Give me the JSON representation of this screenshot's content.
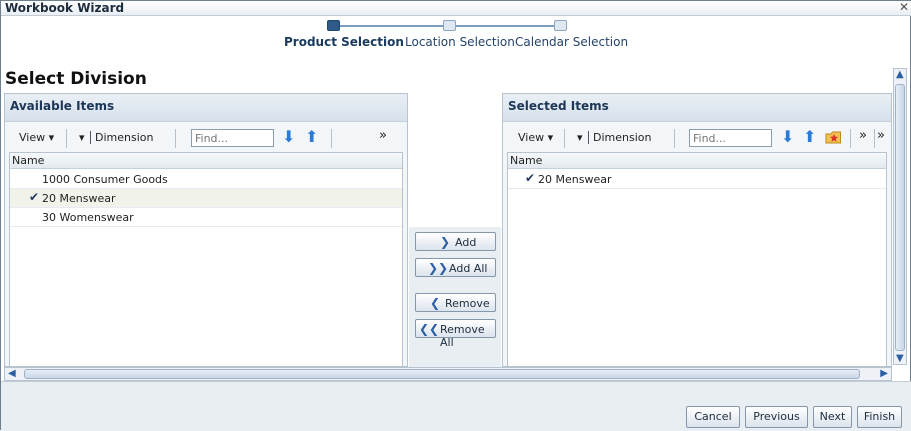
{
  "window": {
    "title": "Workbook Wizard",
    "close_glyph": "✕"
  },
  "train": {
    "steps": [
      {
        "label": "Product Selection",
        "active": true
      },
      {
        "label": "Location Selection",
        "active": false
      },
      {
        "label": "Calendar Selection",
        "active": false
      }
    ]
  },
  "page_title": "Select Division",
  "available": {
    "title": "Available Items",
    "toolbar": {
      "view_label": "View",
      "dimension_label": "Dimension",
      "find_placeholder": "Find...",
      "more": "»"
    },
    "column_header": "Name",
    "rows": [
      {
        "label": "1000 Consumer Goods",
        "checked": false
      },
      {
        "label": "20 Menswear",
        "checked": true
      },
      {
        "label": "30 Womenswear",
        "checked": false
      }
    ]
  },
  "selected": {
    "title": "Selected Items",
    "toolbar": {
      "view_label": "View",
      "dimension_label": "Dimension",
      "find_placeholder": "Find...",
      "more": "»"
    },
    "column_header": "Name",
    "rows": [
      {
        "label": "20 Menswear",
        "checked": true
      }
    ]
  },
  "shuttle": {
    "add": "Add",
    "add_all": "Add All",
    "remove": "Remove",
    "remove_all": "Remove All"
  },
  "footer": {
    "cancel": "Cancel",
    "previous": "Previous",
    "next": "Next",
    "finish": "Finish"
  },
  "glyphs": {
    "check": "✔",
    "caret": "▾",
    "arrow_down": "⬇",
    "arrow_up": "⬆"
  },
  "colors": {
    "accent": "#2e5a8a",
    "panel_bg": "#f3f6f9",
    "footer_bg": "#e9eef3",
    "icon_blue": "#2c7ad6"
  }
}
